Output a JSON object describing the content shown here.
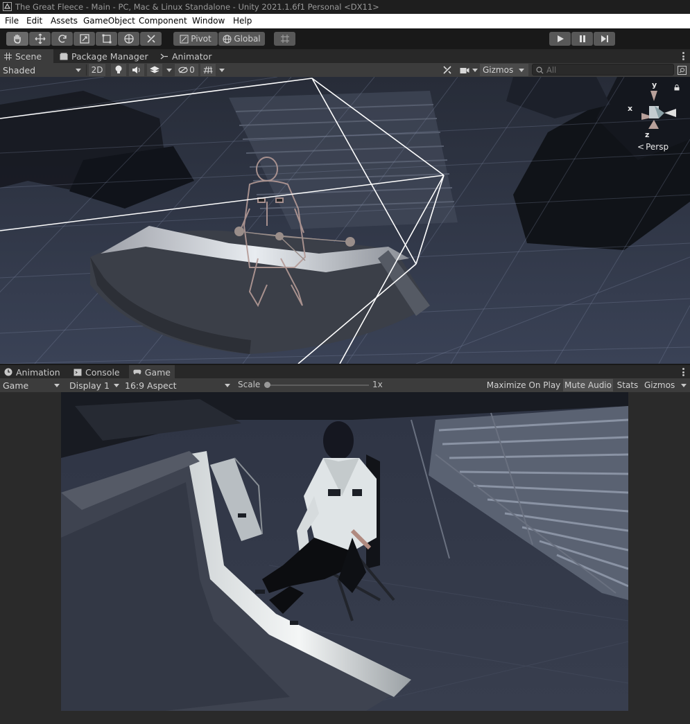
{
  "window": {
    "title": "The Great Fleece - Main - PC, Mac & Linux Standalone - Unity 2021.1.6f1 Personal <DX11>"
  },
  "menu": {
    "items": [
      "File",
      "Edit",
      "Assets",
      "GameObject",
      "Component",
      "Window",
      "Help"
    ]
  },
  "toolbar": {
    "pivot_label": "Pivot",
    "global_label": "Global"
  },
  "scene_panel": {
    "tabs": [
      "Scene",
      "Package Manager",
      "Animator"
    ],
    "shading_mode": "Shaded",
    "mode_2d_label": "2D",
    "hidden_count": "0",
    "gizmos_label": "Gizmos",
    "search_placeholder": "All",
    "orientation_gizmo": {
      "x_label": "x",
      "y_label": "y",
      "z_label": "z",
      "projection_label": "Persp"
    }
  },
  "game_panel": {
    "tabs": [
      "Animation",
      "Console",
      "Game"
    ],
    "view_mode": "Game",
    "display": "Display 1",
    "aspect": "16:9 Aspect",
    "scale_label": "Scale",
    "scale_value": "1x",
    "maximize_label": "Maximize On Play",
    "mute_label": "Mute Audio",
    "stats_label": "Stats",
    "gizmos_label": "Gizmos"
  },
  "colors": {
    "accent_white": "#ffffff",
    "panel_bg": "#3c3c3c",
    "scene_bg": "#2b3140"
  }
}
